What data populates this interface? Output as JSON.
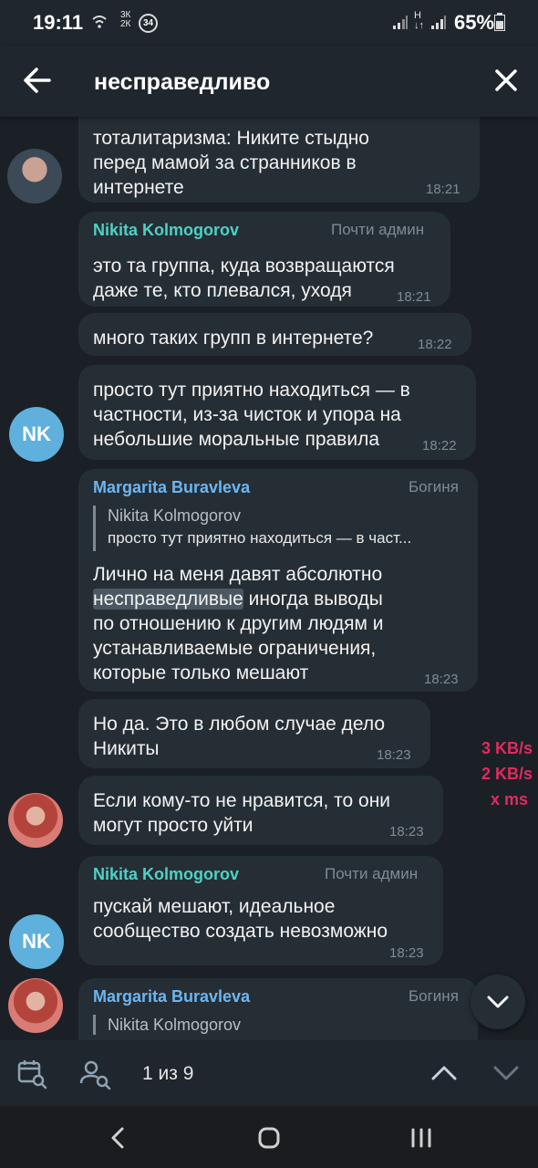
{
  "status_bar": {
    "time": "19:11",
    "indicators": [
      "wifi-icon",
      "speed-meter",
      "notification-34"
    ],
    "data_speed_small": "3 K\n2 K",
    "notification_count": "34",
    "battery": "65%"
  },
  "header": {
    "search_query": "несправедливо"
  },
  "messages": [
    {
      "id": "m1",
      "text_lines": [
        "тоталитаризма: Никите стыдно",
        "перед мамой за странников в",
        "интернете"
      ],
      "time": "18:21"
    },
    {
      "id": "m2",
      "sender": "Nikita Kolmogorov",
      "role": "Почти админ",
      "text_lines": [
        "это та группа, куда возвращаются",
        "даже те, кто плевался, уходя"
      ],
      "time": "18:21"
    },
    {
      "id": "m3",
      "text_lines": [
        "много таких групп в интернете?"
      ],
      "time": "18:22"
    },
    {
      "id": "m4",
      "text_lines": [
        "просто тут приятно находиться — в",
        "частности, из-за чисток и упора на",
        "небольшие моральные правила"
      ],
      "time": "18:22"
    },
    {
      "id": "m5",
      "sender": "Margarita Buravleva",
      "role": "Богиня",
      "reply_to": {
        "name": "Nikita Kolmogorov",
        "text": "просто тут приятно находиться — в част..."
      },
      "text_lines": [
        "Лично на меня давят абсолютно",
        "несправедливые иногда выводы",
        "по отношению к другим людям и",
        "устанавливаемые ограничения,",
        "которые только мешают"
      ],
      "highlight": "несправедливые",
      "time": "18:23"
    },
    {
      "id": "m6",
      "text_lines": [
        "Но да. Это в любом случае дело",
        "Никиты"
      ],
      "time": "18:23"
    },
    {
      "id": "m7",
      "text_lines": [
        "Если кому-то не нравится, то они",
        "могут просто уйти"
      ],
      "time": "18:23"
    },
    {
      "id": "m8",
      "sender": "Nikita Kolmogorov",
      "role": "Почти админ",
      "text_lines": [
        "пускай мешают, идеальное",
        "сообщество создать невозможно"
      ],
      "time": "18:23"
    },
    {
      "id": "m9",
      "sender": "Margarita Buravleva",
      "role": "Богиня",
      "reply_to": {
        "name": "Nikita Kolmogorov"
      }
    }
  ],
  "avatars": {
    "nk_initials": "NK"
  },
  "net_speed_overlay": [
    "3 KB/s",
    "2 KB/s",
    "x  ms"
  ],
  "search_bar": {
    "counter": "1 из 9"
  },
  "colors": {
    "background": "#1a2026",
    "bubble": "#262e35",
    "nikita_name": "#4fd1c5",
    "margarita_name": "#6cb6f0",
    "meta_text": "#7f8a94",
    "net_overlay": "#e22a5f",
    "avatar_nk": "#5fb0dc"
  }
}
